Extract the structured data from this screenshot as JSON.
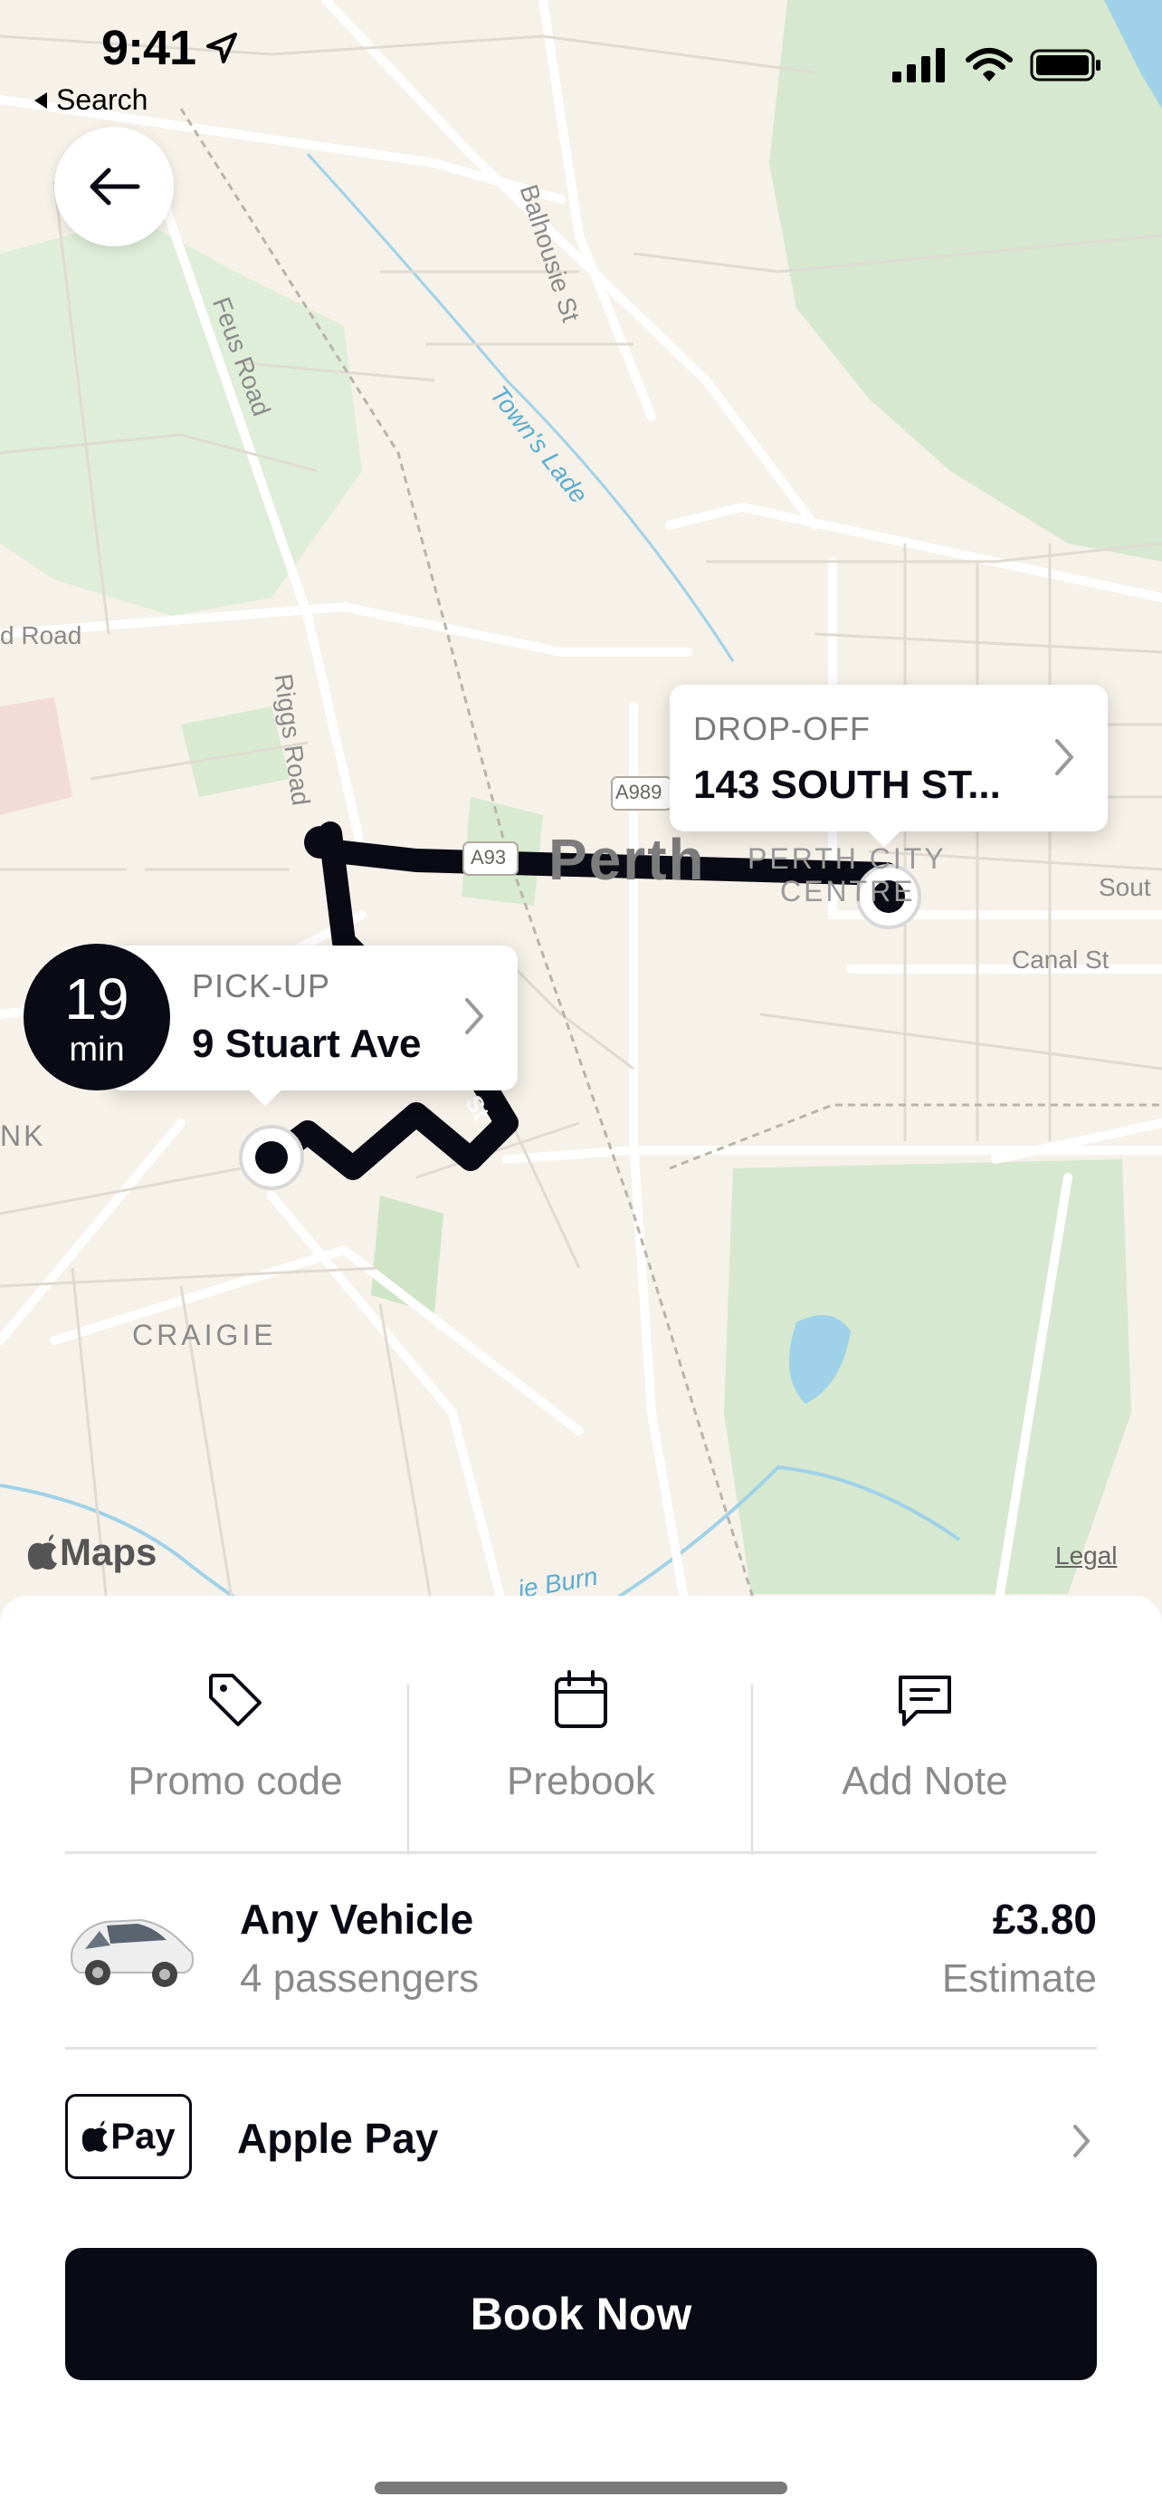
{
  "status_bar": {
    "time": "9:41",
    "back_app": "Search"
  },
  "map": {
    "labels": {
      "bahousie_st": "Balhousie St",
      "feus_road": "Feus Road",
      "towns_lade": "Town's Lade",
      "road_left": "d Road",
      "riggs_road": "Riggs Road",
      "a989": "A989",
      "a93": "A93",
      "perth": "Perth",
      "perth_city_centre_1": "PERTH CITY",
      "perth_city_centre_2": "CENTRE",
      "south": "Sout",
      "canal_st": "Canal St",
      "nk": "NK",
      "craigie": "CRAIGIE",
      "burn": "ie Burn",
      "st": "St"
    },
    "dropoff": {
      "label": "DROP-OFF",
      "address": "143 SOUTH ST..."
    },
    "pickup": {
      "label": "PICK-UP",
      "address": "9 Stuart Ave"
    },
    "eta": {
      "value": "19",
      "unit": "min"
    },
    "maps_brand": "Maps",
    "legal": "Legal"
  },
  "actions": {
    "promo": "Promo code",
    "prebook": "Prebook",
    "note": "Add Note"
  },
  "vehicle": {
    "name": "Any Vehicle",
    "passengers": "4 passengers",
    "price": "£3.80",
    "price_note": "Estimate"
  },
  "payment": {
    "badge": "Pay",
    "label": "Apple Pay"
  },
  "book_button": "Book Now",
  "colors": {
    "primary": "#0a0a14",
    "map_bg": "#f6f1e9",
    "park": "#d6e8cf",
    "water": "#9fd2e8"
  }
}
